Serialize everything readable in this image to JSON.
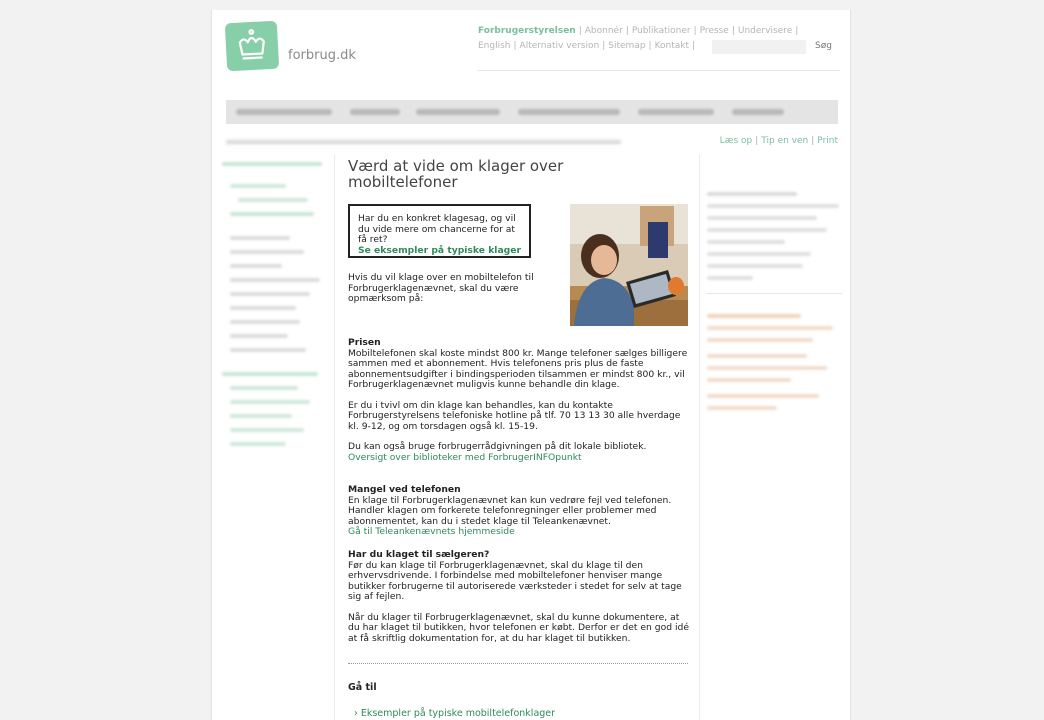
{
  "header": {
    "logo_text": "forbrug.dk",
    "links_row1": [
      "Forbrugerstyrelsen",
      "Abonnér",
      "Publikationer",
      "Presse",
      "Undervisere"
    ],
    "links_row2": [
      "English",
      "Alternativ version",
      "Sitemap",
      "Kontakt"
    ],
    "search_button": "Søg"
  },
  "utility_links": [
    "Læs op",
    "Tip en ven",
    "Print"
  ],
  "main": {
    "title": "Værd at vide om klager over mobiltelefoner",
    "callout_text": "Har du en konkret klagesag, og vil du vide mere om chancerne for at få ret?",
    "callout_link": "Se eksempler på typiske klager",
    "intro": "Hvis du vil klage over en mobiltelefon til Forbrugerklagenævnet, skal du være opmærksom på:",
    "sec1_heading": "Prisen",
    "sec1_text": "Mobiltelefonen skal koste mindst 800 kr. Mange telefoner sælges billigere sammen med et abonnement. Hvis telefonens pris plus de faste abonnementsudgifter i bindingsperioden tilsammen er mindst 800 kr., vil Forbrugerklagenævnet muligvis kunne behandle din klage.",
    "sec1_text2": "Er du i tvivl om din klage kan behandles, kan du kontakte Forbrugerstyrelsens telefoniske hotline på tlf. 70 13 13 30 alle hverdage kl. 9-12, og om torsdagen også kl. 15-19.",
    "sec1_text3": "Du kan også bruge forbrugerrådgivningen på dit lokale bibliotek.",
    "sec1_link": "Oversigt over biblioteker med ForbrugerINFOpunkt",
    "sec2_heading": "Mangel ved telefonen",
    "sec2_text": "En klage til Forbrugerklagenævnet kan kun vedrøre fejl ved telefonen. Handler klagen om forkerete telefonregninger eller problemer med abonnementet, kan du i stedet klage til Teleankenævnet.",
    "sec2_link": "Gå til Teleankenævnets hjemmeside",
    "sec3_heading": "Har du klaget til sælgeren?",
    "sec3_text": "Før du kan klage til Forbrugerklagenævnet, skal du klage til den erhvervsdrivende. I forbindelse med mobiltelefoner henviser mange butikker forbrugerne til autoriserede værksteder i stedet for selv at tage sig af fejlen.",
    "sec3_text2": "Når du klager til Forbrugerklagenævnet, skal du kunne dokumentere, at du har klaget til butikken, hvor telefonen er købt. Derfor er det en god idé at få skriftlig dokumentation for, at du har klaget til butikken.",
    "goto_heading": "Gå til",
    "goto_link": "Eksempler på typiske mobiltelefonklager",
    "goto_arrow": "›"
  },
  "colors": {
    "accent": "#2e8a5c",
    "logo_green": "#86cfa8"
  }
}
